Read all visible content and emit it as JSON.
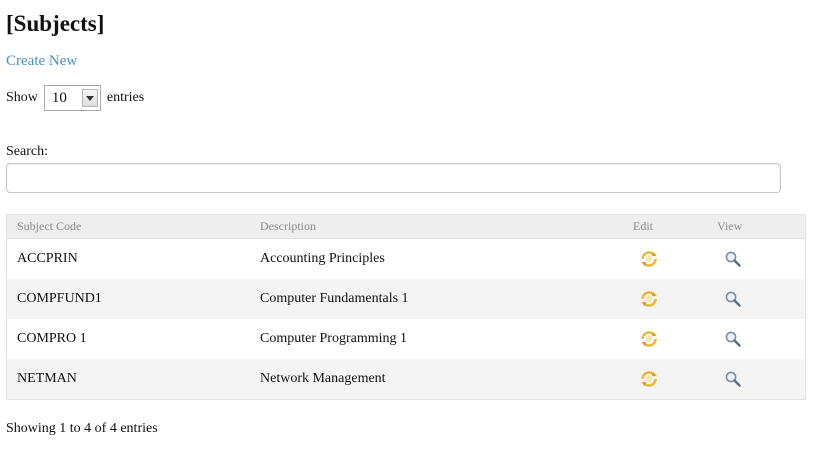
{
  "page": {
    "title": "[Subjects]",
    "create_new": "Create New"
  },
  "length_menu": {
    "show_label": "Show",
    "selected": "10",
    "entries_label": "entries"
  },
  "search": {
    "label": "Search:",
    "value": "",
    "placeholder": ""
  },
  "table": {
    "headers": {
      "code": "Subject Code",
      "description": "Description",
      "edit": "Edit",
      "view": "View"
    },
    "rows": [
      {
        "code": "ACCPRIN",
        "description": "Accounting Principles"
      },
      {
        "code": "COMPFUND1",
        "description": "Computer Fundamentals 1"
      },
      {
        "code": "COMPRO 1",
        "description": "Computer Programming 1"
      },
      {
        "code": "NETMAN",
        "description": "Network Management"
      }
    ],
    "edit_icon": "refresh-icon",
    "view_icon": "magnifier-icon"
  },
  "footer": {
    "info": "Showing 1 to 4 of 4 entries"
  },
  "colors": {
    "link": "#4a90c8",
    "header_bg": "#eeeeee",
    "alt_row_bg": "#f4f4f4",
    "edit_icon": "#e8b93a"
  }
}
